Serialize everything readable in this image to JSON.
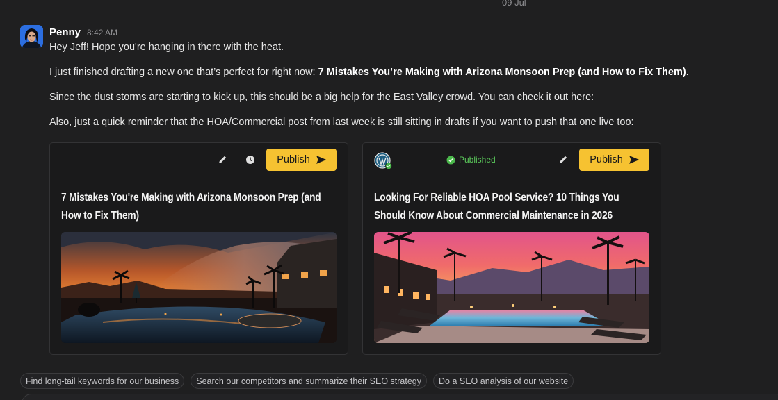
{
  "divider": {
    "date": "09 Jul"
  },
  "message": {
    "sender": "Penny",
    "time": "8:42 AM",
    "lines": {
      "greeting": "Hey Jeff! Hope you're hanging in there with the heat.",
      "draft_prefix": "I just finished drafting a new one that’s perfect for right now: ",
      "draft_title": "7 Mistakes You’re Making with Arizona Monsoon Prep (and How to Fix Them)",
      "draft_suffix": ".",
      "dust": "Since the dust storms are starting to kick up, this should be a big help for the East Valley crowd. You can check it out here:",
      "reminder": "Also, just a quick reminder that the HOA/Commercial post from last week is still sitting in drafts if you want to push that one live too:"
    }
  },
  "cards": [
    {
      "title": "7 Mistakes You're Making with Arizona Monsoon Prep (and How to Fix Them)",
      "publish_label": "Publish",
      "icons": [
        "pencil-icon",
        "clock-icon",
        "send-icon"
      ]
    },
    {
      "status": "Published",
      "title": "Looking For Reliable HOA Pool Service? 10 Things You Should Know About Commercial Maintenance in 2026",
      "publish_label": "Publish",
      "icons": [
        "wordpress-icon",
        "check-circle-icon",
        "pencil-icon",
        "send-icon"
      ]
    }
  ],
  "suggestions": [
    "Find long-tail keywords for our business",
    "Search our competitors and summarize their SEO strategy",
    "Do a SEO analysis of our website"
  ],
  "colors": {
    "accent": "#f6c231",
    "success": "#5ac85a",
    "background": "#1f1f20"
  }
}
